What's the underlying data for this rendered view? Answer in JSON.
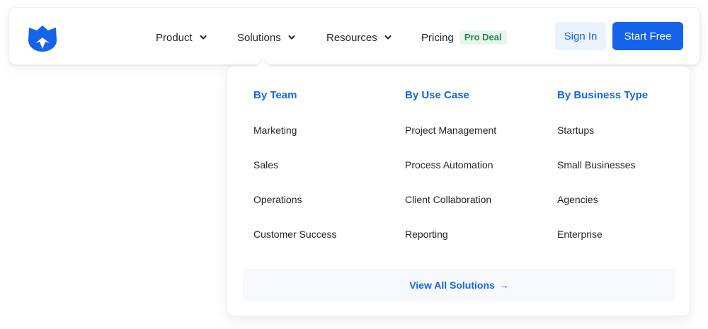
{
  "nav": {
    "items": [
      {
        "label": "Product"
      },
      {
        "label": "Solutions"
      },
      {
        "label": "Resources"
      },
      {
        "label": "Pricing",
        "badge": "Pro Deal"
      }
    ],
    "sign_in": "Sign In",
    "start_free": "Start Free"
  },
  "dropdown": {
    "columns": [
      {
        "heading": "By Team",
        "links": [
          "Marketing",
          "Sales",
          "Operations",
          "Customer Success"
        ]
      },
      {
        "heading": "By Use Case",
        "links": [
          "Project Management",
          "Process Automation",
          "Client Collaboration",
          "Reporting"
        ]
      },
      {
        "heading": "By Business Type",
        "links": [
          "Startups",
          "Small Businesses",
          "Agencies",
          "Enterprise"
        ]
      }
    ],
    "view_all": "View All Solutions",
    "view_all_arrow": "→"
  },
  "colors": {
    "accent": "#1463ea",
    "badge_bg": "#e7f6ec",
    "badge_text": "#1e8a4c",
    "signin_bg": "#eaf2fe"
  },
  "icons": [
    "logo-icon",
    "chevron-down-icon",
    "arrow-right-icon"
  ]
}
